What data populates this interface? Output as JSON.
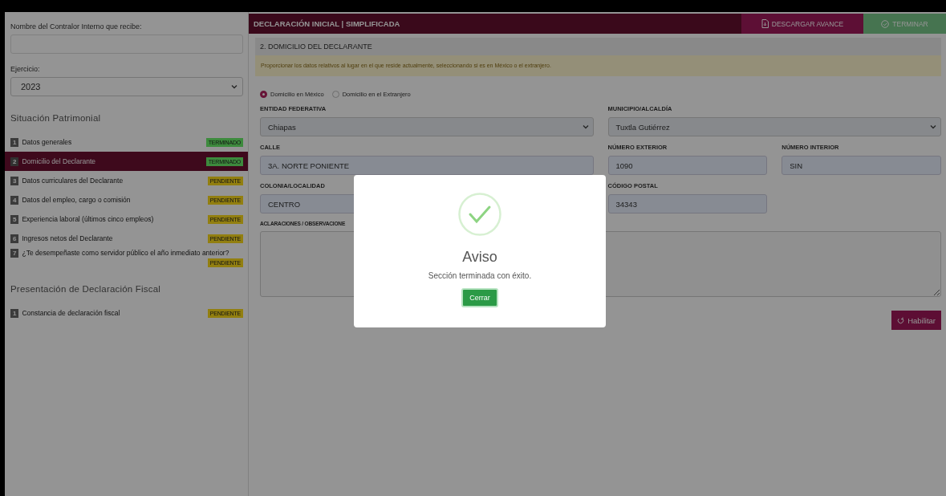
{
  "sidebar": {
    "contralor_label": "Nombre del Contralor Interno que recibe:",
    "ejercicio_label": "Ejercicio:",
    "ejercicio_value": "2023",
    "sections": [
      {
        "title": "Situación Patrimonial",
        "items": [
          {
            "number": "1",
            "label": "Datos generales",
            "status": "TERMINADO",
            "color": "#3d8a3d",
            "selected": false
          },
          {
            "number": "2",
            "label": "Domicilio del Declarante",
            "status": "TERMINADO",
            "color": "#3d8a3d",
            "selected": true
          },
          {
            "number": "3",
            "label": "Datos curriculares del Declarante",
            "status": "PENDIENTE",
            "color": "#927f10",
            "selected": false
          },
          {
            "number": "4",
            "label": "Datos del empleo, cargo o comisión",
            "status": "PENDIENTE",
            "color": "#927f10",
            "selected": false
          },
          {
            "number": "5",
            "label": "Experiencia laboral (últimos cinco empleos)",
            "status": "PENDIENTE",
            "color": "#927f10",
            "selected": false
          },
          {
            "number": "6",
            "label": "Ingresos netos del Declarante",
            "status": "PENDIENTE",
            "color": "#927f10",
            "selected": false
          },
          {
            "number": "7",
            "label": "¿Te desempeñaste como servidor público el año inmediato anterior?",
            "status": "PENDIENTE",
            "color": "#927f10",
            "selected": false
          }
        ]
      },
      {
        "title": "Presentación de Declaración Fiscal",
        "items": [
          {
            "number": "1",
            "label": "Constancia de declaración fiscal",
            "status": "PENDIENTE",
            "color": "#927f10",
            "selected": false
          }
        ]
      }
    ]
  },
  "header": {
    "title": "DECLARACIÓN INICIAL | SIMPLIFICADA",
    "buttons": [
      {
        "label": "DESCARGAR AVANCE",
        "kind": "download"
      },
      {
        "label": "TERMINAR",
        "kind": "finish"
      }
    ]
  },
  "form": {
    "section_title": "2. DOMICILIO DEL DECLARANTE",
    "notice": "Proporcionar los datos relativos al lugar en el que reside actualmente, seleccionando si es en México o el extranjero.",
    "radios": [
      {
        "label": "Domicilio en México",
        "selected": true
      },
      {
        "label": "Domicilio en el Extranjero",
        "selected": false
      }
    ],
    "rows": [
      [
        {
          "label": "ENTIDAD FEDERATIVA",
          "value": "Chiapas",
          "kind": "select"
        },
        {
          "label": "MUNICIPIO/ALCALDÍA",
          "value": "Tuxtla Gutiérrez",
          "kind": "select"
        }
      ],
      [
        {
          "label": "CALLE",
          "value": "3A. NORTE PONIENTE",
          "kind": "input"
        },
        {
          "label": "NÚMERO EXTERIOR",
          "value": "1090",
          "kind": "input"
        },
        {
          "label": "NÚMERO INTERIOR",
          "value": "SIN",
          "kind": "input"
        }
      ],
      [
        {
          "label": "COLONIA/LOCALIDAD",
          "value": "CENTRO",
          "kind": "input"
        },
        {
          "label": "CÓDIGO POSTAL",
          "value": "34343",
          "kind": "input"
        }
      ],
      [
        {
          "label": "ACLARACIONES / OBSERVACIONE",
          "kind": "textarea"
        }
      ]
    ],
    "action": "Habilitar"
  },
  "modal": {
    "title": "Aviso",
    "message": "Sección terminada con éxito.",
    "button": "Cerrar"
  }
}
